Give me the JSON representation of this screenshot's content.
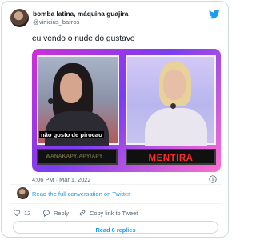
{
  "author": {
    "display_name": "bomba latina, máquina guajira",
    "handle": "@vinicius_barros",
    "avatar_icon": "profile-avatar"
  },
  "brand": {
    "icon": "twitter-bird-icon",
    "color": "#1d9bf0"
  },
  "tweet": {
    "text": "eu vendo o nude do gustavo",
    "timestamp": "4:06 PM · Mar 1, 2022"
  },
  "media": {
    "left_caption": "não gosto de pirocao",
    "left_bar_text": "WANAKAPY/APY/APY",
    "right_bar_text": "MENTIRA",
    "right_bar_color": "#ff2a2a"
  },
  "conversation": {
    "link_text": "Read the full conversation on Twitter"
  },
  "actions": {
    "like_count": "12",
    "reply_label": "Reply",
    "copy_link_label": "Copy link to Tweet"
  },
  "footer": {
    "read_replies_label": "Read 6 replies"
  }
}
